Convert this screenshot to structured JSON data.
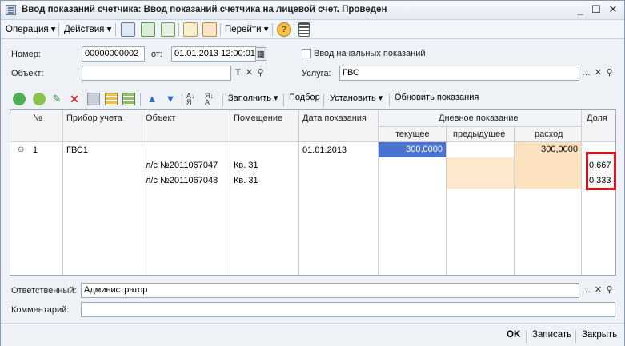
{
  "window": {
    "title": "Ввод показаний счетчика: Ввод показаний счетчика на лицевой счет. Проведен",
    "minimize": "_",
    "maximize": "☐",
    "close": "✕"
  },
  "toolbar": {
    "operation": "Операция ▾",
    "actions": "Действия ▾",
    "goto": "Перейти ▾"
  },
  "form": {
    "number_label": "Номер:",
    "number_value": "00000000002",
    "date_label": "от:",
    "date_value": "01.01.2013 12:00:01",
    "initial_readings_label": "Ввод начальных показаний",
    "object_label": "Объект:",
    "object_value": "",
    "service_label": "Услуга:",
    "service_value": "ГВС",
    "responsible_label": "Ответственный:",
    "responsible_value": "Администратор",
    "comment_label": "Комментарий:",
    "comment_value": ""
  },
  "gridbar": {
    "fill": "Заполнить ▾",
    "select": "Подбор",
    "set": "Установить ▾",
    "update": "Обновить показания"
  },
  "grid": {
    "headers": {
      "num": "№",
      "meter": "Прибор учета",
      "object": "Объект",
      "premises": "Помещение",
      "date": "Дата показания",
      "day_reading": "Дневное показание",
      "current": "текущее",
      "previous": "предыдущее",
      "consumption": "расход",
      "share": "Доля"
    },
    "rows": [
      {
        "num": "1",
        "meter": "ГВС1",
        "object": "",
        "premises": "",
        "date": "01.01.2013",
        "current": "300,0000",
        "previous": "",
        "consumption": "300,0000",
        "share": ""
      },
      {
        "num": "",
        "meter": "",
        "object": "л/с №2011067047",
        "premises": "Кв. 31",
        "date": "",
        "current": "",
        "previous": "",
        "consumption": "",
        "share": "0,667"
      },
      {
        "num": "",
        "meter": "",
        "object": "л/с №2011067048",
        "premises": "Кв. 31",
        "date": "",
        "current": "",
        "previous": "",
        "consumption": "",
        "share": "0,333"
      }
    ]
  },
  "footer": {
    "ok": "OK",
    "save": "Записать",
    "close": "Закрыть"
  },
  "colors": {
    "selected_cell": "#4a73d0",
    "peach": "#fde8cc",
    "highlight_box": "#e0101a"
  }
}
